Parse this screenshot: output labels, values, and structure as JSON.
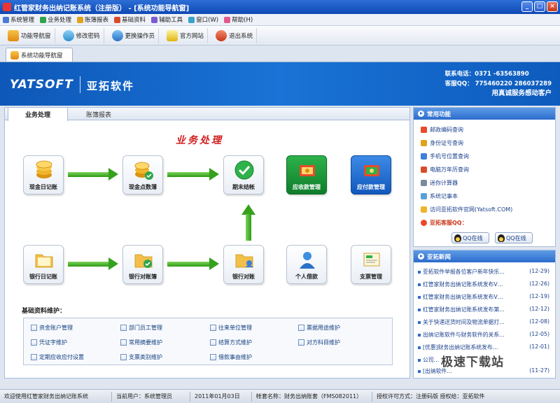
{
  "window": {
    "title": "红管家财务出纳记账系统（注册版） - [系统功能导航窗]"
  },
  "menu": {
    "items": [
      "系统管理",
      "业务处理",
      "账簿报表",
      "基础资料",
      "辅助工具",
      "窗口(W)",
      "帮助(H)"
    ]
  },
  "toolbar": {
    "items": [
      "功能导航窗",
      "修改密码",
      "更换操作员",
      "官方网站",
      "退出系统"
    ]
  },
  "doc_tab": {
    "label": "系统功能导航窗"
  },
  "banner": {
    "logo": "YATSOFT",
    "logo_cn": "亚拓软件",
    "phone": "联系电话：0371 -63563890",
    "qq": "客服QQ： 775460220   286037289",
    "slogan": "用真诚服务感动客户"
  },
  "main": {
    "tabs": [
      "业务处理",
      "账簿报表"
    ],
    "section_title": "业务处理",
    "flow": {
      "cash_journal": "现金日记账",
      "cash_count": "现金点数薄",
      "period_close": "期末结帐",
      "receivable": "应收款管理",
      "payable": "应付款管理",
      "bank_journal": "银行日记账",
      "bank_statement": "银行对账簿",
      "bank_reconcile": "银行对账",
      "personal_loan": "个人借款",
      "check_mgmt": "支票管理"
    },
    "basic_title": "基础资料维护：",
    "basic_items": [
      "资金账户管理",
      "部门员工管理",
      "往来单位管理",
      "票据用途维护",
      "凭证字维护",
      "常用摘要维护",
      "结算方式维护",
      "对方科目维护",
      "定期应收应付设置",
      "支票类别维护",
      "借款事由维护"
    ]
  },
  "common": {
    "title": "常用功能",
    "tools": [
      "邮政编码查询",
      "身份证号查询",
      "手机号位置查询",
      "电脑万年历查询",
      "迷你计算器",
      "系统记事本",
      "访问亚拓软件官网(Yatsoft.COM)"
    ],
    "support_label": "亚拓客服QQ：",
    "qq_buttons": [
      "QQ在线",
      "QQ在线"
    ]
  },
  "news": {
    "title": "亚拓新闻",
    "items": [
      {
        "text": "亚拓软件举报各位客户新年快乐…",
        "date": "(12-29)"
      },
      {
        "text": "红管家财务出纳记账系统发布V…",
        "date": "(12-26)"
      },
      {
        "text": "红管家财务出纳记账系统发布V…",
        "date": "(12-19)"
      },
      {
        "text": "红管家财务出纳记账系统发布第…",
        "date": "(12-12)"
      },
      {
        "text": "关于快递送货时间及物流单据打…",
        "date": "(12-08)"
      },
      {
        "text": "出纳记账软件与财务软件的关系…",
        "date": "(12-05)"
      },
      {
        "text": "[优惠]财务出纳记账系统发布…",
        "date": "(12-01)"
      },
      {
        "text": "公司…",
        "date": ""
      },
      {
        "text": "[出纳软件…",
        "date": "(11-27)"
      }
    ]
  },
  "status": {
    "welcome": "欢迎使用红管家财务出纳记账系统",
    "user": "当前用户：系统管理员",
    "date": "2011年01月03日",
    "account": "帐套名称：财务出纳账套（FMS082011）",
    "license": "授权许可方式：注册码版  授权给：亚拓软件"
  },
  "watermark": "极速下载站",
  "colors": {
    "banner": "#1a73d6",
    "title_red": "#d21e1e",
    "arrow_green": "#36a11c"
  }
}
